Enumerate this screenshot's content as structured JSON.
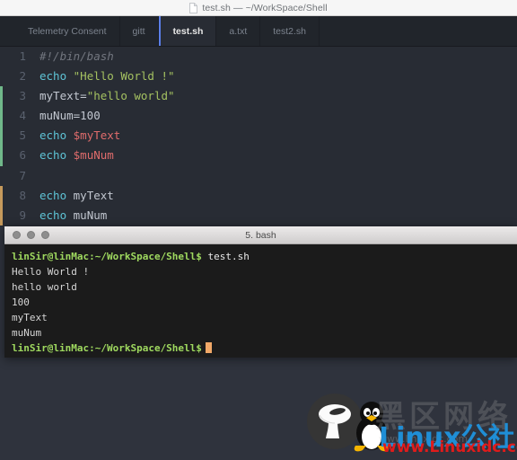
{
  "window": {
    "doc_icon": "document-icon",
    "title": "test.sh — ~/WorkSpace/Shell"
  },
  "tabs": [
    {
      "label": "Telemetry Consent",
      "active": false
    },
    {
      "label": "gitt",
      "active": false
    },
    {
      "label": "test.sh",
      "active": true
    },
    {
      "label": "a.txt",
      "active": false
    },
    {
      "label": "test2.sh",
      "active": false
    }
  ],
  "editor": {
    "accent_active_tab": "#5b7fe8",
    "background": "#282c34",
    "lines": [
      {
        "num": "1",
        "marker": "none",
        "text": "#!/bin/bash"
      },
      {
        "num": "2",
        "marker": "none",
        "text": "echo \"Hello World !\""
      },
      {
        "num": "3",
        "marker": "added",
        "text": "myText=\"hello world\""
      },
      {
        "num": "4",
        "marker": "added",
        "text": "muNum=100"
      },
      {
        "num": "5",
        "marker": "added",
        "text": "echo $myText"
      },
      {
        "num": "6",
        "marker": "added",
        "text": "echo $muNum"
      },
      {
        "num": "7",
        "marker": "none",
        "text": ""
      },
      {
        "num": "8",
        "marker": "modified",
        "text": "echo myText"
      },
      {
        "num": "9",
        "marker": "none",
        "text": "echo muNum"
      }
    ]
  },
  "terminal": {
    "title": "5. bash",
    "prompt": "linSir@linMac:~/WorkSpace/Shell$",
    "command": " test.sh",
    "output": [
      "Hello World !",
      "hello world",
      "100",
      "myText",
      "muNum"
    ],
    "prompt_color": "#9fd95f",
    "cursor_color": "#f0a868",
    "background": "#1b1b1b"
  },
  "watermark": {
    "mushroom_icon": "mushroom-logo-icon",
    "tux_icon": "tux-penguin-icon",
    "cn_gray": "黑区网络",
    "cn_blue": "Linux公社",
    "url_gray": "www.linuxidc.com",
    "url_red": "www.Linuxidc.com",
    "blue": "#1f8ed6",
    "red": "#e01b1b"
  }
}
